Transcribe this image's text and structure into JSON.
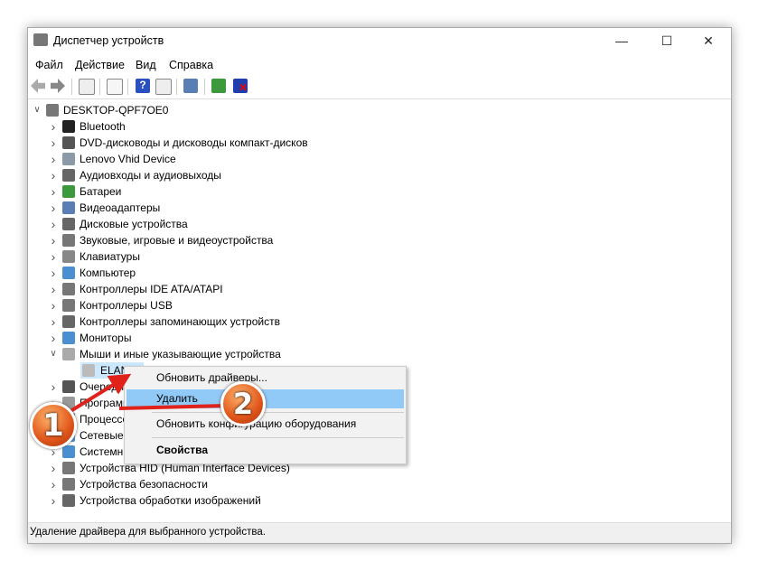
{
  "window": {
    "title": "Диспетчер устройств",
    "minimize": "—",
    "maximize": "☐",
    "close": "✕"
  },
  "menu": [
    "Файл",
    "Действие",
    "Вид",
    "Справка"
  ],
  "toolbar": [
    "back-icon",
    "forward-icon",
    "show-hide-tree-icon",
    "properties-icon",
    "help-icon",
    "action-pane-icon",
    "scan-hardware-icon",
    "update-driver-icon",
    "uninstall-device-icon"
  ],
  "tree": {
    "root": "DESKTOP-QPF7OE0",
    "items": [
      {
        "label": "Bluetooth",
        "expanded": false
      },
      {
        "label": "DVD-дисководы и дисководы компакт-дисков",
        "expanded": false
      },
      {
        "label": "Lenovo Vhid Device",
        "expanded": false
      },
      {
        "label": "Аудиовходы и аудиовыходы",
        "expanded": false
      },
      {
        "label": "Батареи",
        "expanded": false
      },
      {
        "label": "Видеоадаптеры",
        "expanded": false
      },
      {
        "label": "Дисковые устройства",
        "expanded": false
      },
      {
        "label": "Звуковые, игровые и видеоустройства",
        "expanded": false
      },
      {
        "label": "Клавиатуры",
        "expanded": false
      },
      {
        "label": "Компьютер",
        "expanded": false
      },
      {
        "label": "Контроллеры IDE ATA/ATAPI",
        "expanded": false
      },
      {
        "label": "Контроллеры USB",
        "expanded": false
      },
      {
        "label": "Контроллеры запоминающих устройств",
        "expanded": false
      },
      {
        "label": "Мониторы",
        "expanded": false
      },
      {
        "label": "Мыши и иные указывающие устройства",
        "expanded": true
      },
      {
        "label": "ELAN",
        "child": true
      },
      {
        "label": "Очереди печати",
        "expanded": false
      },
      {
        "label": "Программные устройства",
        "expanded": false
      },
      {
        "label": "Процессоры",
        "expanded": false
      },
      {
        "label": "Сетевые адаптеры",
        "expanded": false
      },
      {
        "label": "Системные устройства",
        "expanded": false
      },
      {
        "label": "Устройства HID (Human Interface Devices)",
        "expanded": false
      },
      {
        "label": "Устройства безопасности",
        "expanded": false
      },
      {
        "label": "Устройства обработки изображений",
        "expanded": false
      }
    ]
  },
  "context_menu": {
    "items": [
      "Обновить драйверы...",
      "Удалить",
      "Обновить конфигурацию оборудования",
      "Свойства"
    ],
    "highlighted": "Удалить"
  },
  "status": "Удаление драйвера для выбранного устройства.",
  "annotations": {
    "badge1": "1",
    "badge2": "2",
    "color": "#e0221a"
  }
}
